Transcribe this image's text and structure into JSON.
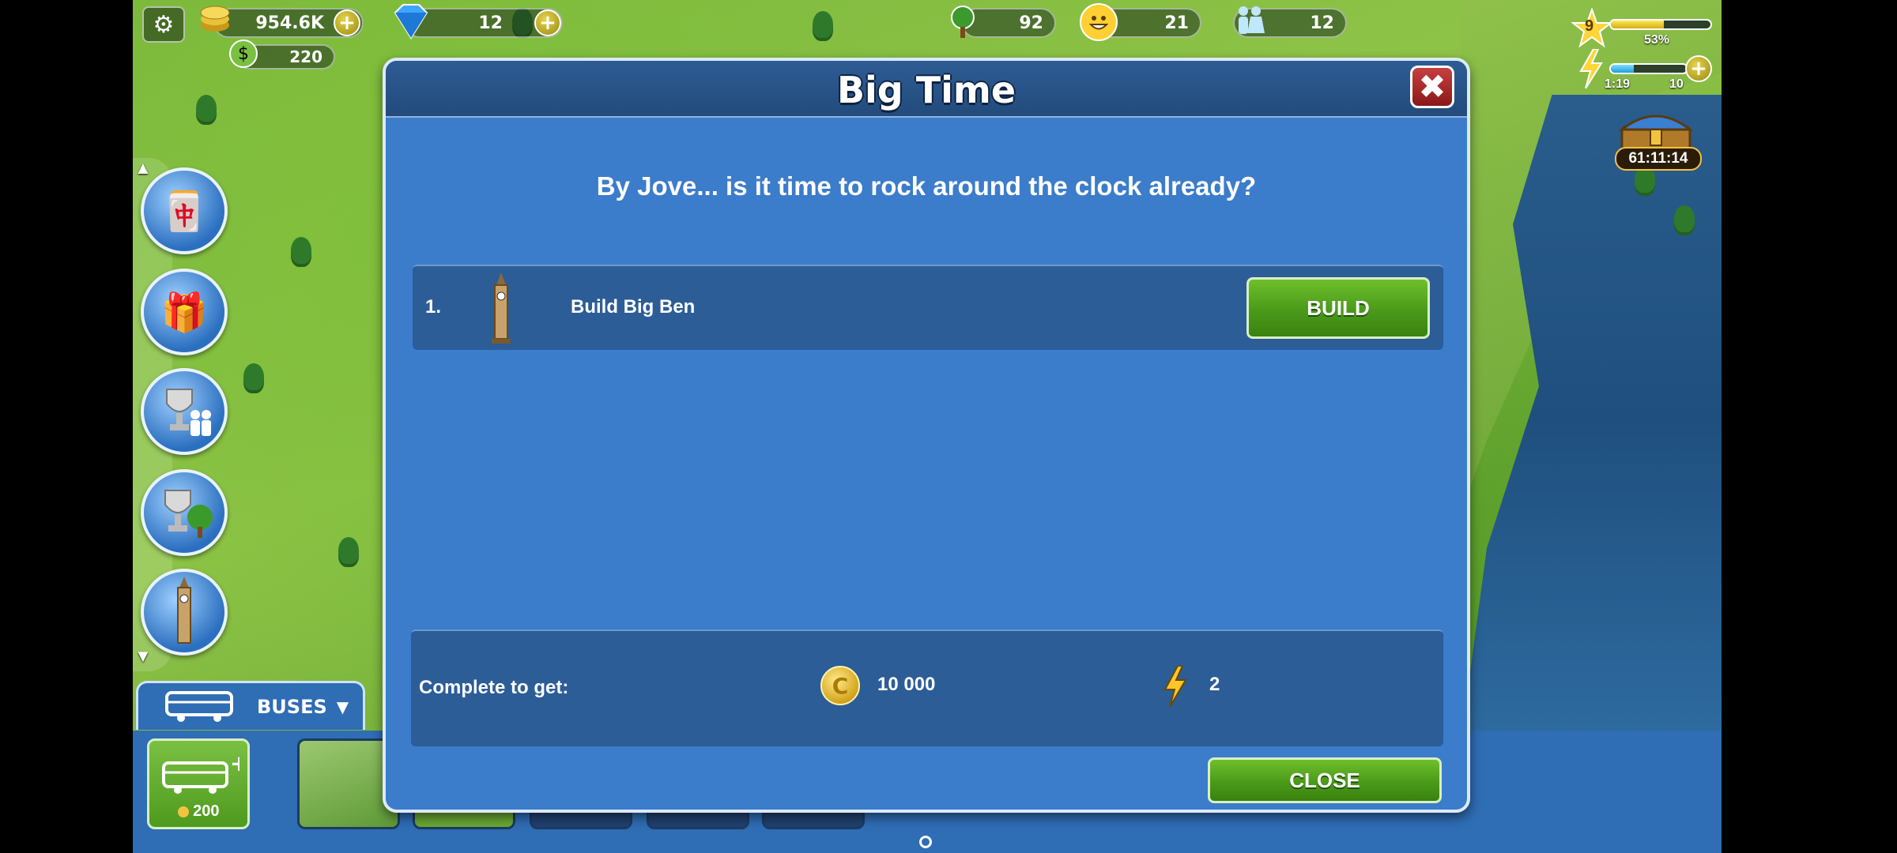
{
  "hud": {
    "coins": "954.6K",
    "gems": "12",
    "cash": "220",
    "trees": "92",
    "happiness": "21",
    "population": "12",
    "level": "9",
    "xp_percent_label": "53%",
    "xp_fill": 0.53,
    "energy_time": "1:19",
    "energy_max": "10",
    "energy_fill": 0.3,
    "chest_timer": "61:11:14"
  },
  "bus_panel": {
    "tab_label": "BUSES",
    "buy_price": "200"
  },
  "dialog": {
    "title": "Big Time",
    "subtitle": "By Jove... is it time to rock around the clock already?",
    "task": {
      "number": "1.",
      "label": "Build Big Ben",
      "button": "BUILD"
    },
    "rewards": {
      "label": "Complete to get:",
      "coins": "10 000",
      "energy": "2"
    },
    "close_button": "CLOSE",
    "close_symbol": "✖"
  },
  "icons": {
    "settings": "gear-icon",
    "coin": "coin-icon",
    "gem": "gem-icon",
    "cash": "cash-icon",
    "tree": "tree-icon",
    "smile": "smile-icon",
    "people": "people-icon",
    "star": "star-icon",
    "bolt": "lightning-icon",
    "chest": "treasure-chest-icon",
    "bus": "bus-icon",
    "big_ben": "big-ben-icon"
  },
  "colors": {
    "dialog_bg": "#3b7ccb",
    "dialog_title_bg": "#2d5c94",
    "button_green": "#4a9a1a",
    "close_red": "#a82a2a"
  }
}
